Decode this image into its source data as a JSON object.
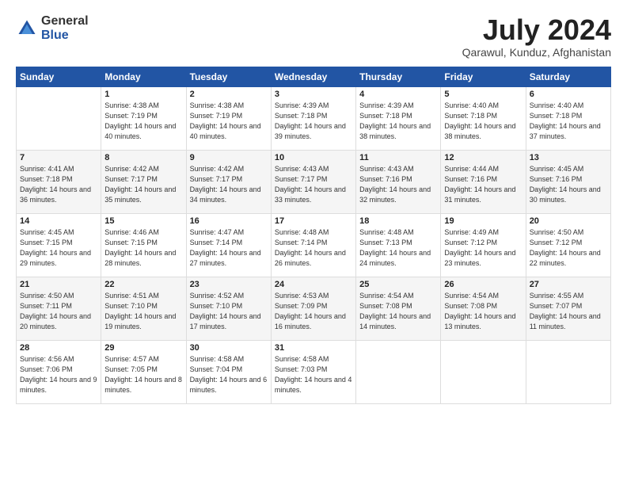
{
  "logo": {
    "general": "General",
    "blue": "Blue"
  },
  "title": "July 2024",
  "location": "Qarawul, Kunduz, Afghanistan",
  "days_header": [
    "Sunday",
    "Monday",
    "Tuesday",
    "Wednesday",
    "Thursday",
    "Friday",
    "Saturday"
  ],
  "weeks": [
    [
      {
        "num": "",
        "sunrise": "",
        "sunset": "",
        "daylight": ""
      },
      {
        "num": "1",
        "sunrise": "Sunrise: 4:38 AM",
        "sunset": "Sunset: 7:19 PM",
        "daylight": "Daylight: 14 hours and 40 minutes."
      },
      {
        "num": "2",
        "sunrise": "Sunrise: 4:38 AM",
        "sunset": "Sunset: 7:19 PM",
        "daylight": "Daylight: 14 hours and 40 minutes."
      },
      {
        "num": "3",
        "sunrise": "Sunrise: 4:39 AM",
        "sunset": "Sunset: 7:18 PM",
        "daylight": "Daylight: 14 hours and 39 minutes."
      },
      {
        "num": "4",
        "sunrise": "Sunrise: 4:39 AM",
        "sunset": "Sunset: 7:18 PM",
        "daylight": "Daylight: 14 hours and 38 minutes."
      },
      {
        "num": "5",
        "sunrise": "Sunrise: 4:40 AM",
        "sunset": "Sunset: 7:18 PM",
        "daylight": "Daylight: 14 hours and 38 minutes."
      },
      {
        "num": "6",
        "sunrise": "Sunrise: 4:40 AM",
        "sunset": "Sunset: 7:18 PM",
        "daylight": "Daylight: 14 hours and 37 minutes."
      }
    ],
    [
      {
        "num": "7",
        "sunrise": "Sunrise: 4:41 AM",
        "sunset": "Sunset: 7:18 PM",
        "daylight": "Daylight: 14 hours and 36 minutes."
      },
      {
        "num": "8",
        "sunrise": "Sunrise: 4:42 AM",
        "sunset": "Sunset: 7:17 PM",
        "daylight": "Daylight: 14 hours and 35 minutes."
      },
      {
        "num": "9",
        "sunrise": "Sunrise: 4:42 AM",
        "sunset": "Sunset: 7:17 PM",
        "daylight": "Daylight: 14 hours and 34 minutes."
      },
      {
        "num": "10",
        "sunrise": "Sunrise: 4:43 AM",
        "sunset": "Sunset: 7:17 PM",
        "daylight": "Daylight: 14 hours and 33 minutes."
      },
      {
        "num": "11",
        "sunrise": "Sunrise: 4:43 AM",
        "sunset": "Sunset: 7:16 PM",
        "daylight": "Daylight: 14 hours and 32 minutes."
      },
      {
        "num": "12",
        "sunrise": "Sunrise: 4:44 AM",
        "sunset": "Sunset: 7:16 PM",
        "daylight": "Daylight: 14 hours and 31 minutes."
      },
      {
        "num": "13",
        "sunrise": "Sunrise: 4:45 AM",
        "sunset": "Sunset: 7:16 PM",
        "daylight": "Daylight: 14 hours and 30 minutes."
      }
    ],
    [
      {
        "num": "14",
        "sunrise": "Sunrise: 4:45 AM",
        "sunset": "Sunset: 7:15 PM",
        "daylight": "Daylight: 14 hours and 29 minutes."
      },
      {
        "num": "15",
        "sunrise": "Sunrise: 4:46 AM",
        "sunset": "Sunset: 7:15 PM",
        "daylight": "Daylight: 14 hours and 28 minutes."
      },
      {
        "num": "16",
        "sunrise": "Sunrise: 4:47 AM",
        "sunset": "Sunset: 7:14 PM",
        "daylight": "Daylight: 14 hours and 27 minutes."
      },
      {
        "num": "17",
        "sunrise": "Sunrise: 4:48 AM",
        "sunset": "Sunset: 7:14 PM",
        "daylight": "Daylight: 14 hours and 26 minutes."
      },
      {
        "num": "18",
        "sunrise": "Sunrise: 4:48 AM",
        "sunset": "Sunset: 7:13 PM",
        "daylight": "Daylight: 14 hours and 24 minutes."
      },
      {
        "num": "19",
        "sunrise": "Sunrise: 4:49 AM",
        "sunset": "Sunset: 7:12 PM",
        "daylight": "Daylight: 14 hours and 23 minutes."
      },
      {
        "num": "20",
        "sunrise": "Sunrise: 4:50 AM",
        "sunset": "Sunset: 7:12 PM",
        "daylight": "Daylight: 14 hours and 22 minutes."
      }
    ],
    [
      {
        "num": "21",
        "sunrise": "Sunrise: 4:50 AM",
        "sunset": "Sunset: 7:11 PM",
        "daylight": "Daylight: 14 hours and 20 minutes."
      },
      {
        "num": "22",
        "sunrise": "Sunrise: 4:51 AM",
        "sunset": "Sunset: 7:10 PM",
        "daylight": "Daylight: 14 hours and 19 minutes."
      },
      {
        "num": "23",
        "sunrise": "Sunrise: 4:52 AM",
        "sunset": "Sunset: 7:10 PM",
        "daylight": "Daylight: 14 hours and 17 minutes."
      },
      {
        "num": "24",
        "sunrise": "Sunrise: 4:53 AM",
        "sunset": "Sunset: 7:09 PM",
        "daylight": "Daylight: 14 hours and 16 minutes."
      },
      {
        "num": "25",
        "sunrise": "Sunrise: 4:54 AM",
        "sunset": "Sunset: 7:08 PM",
        "daylight": "Daylight: 14 hours and 14 minutes."
      },
      {
        "num": "26",
        "sunrise": "Sunrise: 4:54 AM",
        "sunset": "Sunset: 7:08 PM",
        "daylight": "Daylight: 14 hours and 13 minutes."
      },
      {
        "num": "27",
        "sunrise": "Sunrise: 4:55 AM",
        "sunset": "Sunset: 7:07 PM",
        "daylight": "Daylight: 14 hours and 11 minutes."
      }
    ],
    [
      {
        "num": "28",
        "sunrise": "Sunrise: 4:56 AM",
        "sunset": "Sunset: 7:06 PM",
        "daylight": "Daylight: 14 hours and 9 minutes."
      },
      {
        "num": "29",
        "sunrise": "Sunrise: 4:57 AM",
        "sunset": "Sunset: 7:05 PM",
        "daylight": "Daylight: 14 hours and 8 minutes."
      },
      {
        "num": "30",
        "sunrise": "Sunrise: 4:58 AM",
        "sunset": "Sunset: 7:04 PM",
        "daylight": "Daylight: 14 hours and 6 minutes."
      },
      {
        "num": "31",
        "sunrise": "Sunrise: 4:58 AM",
        "sunset": "Sunset: 7:03 PM",
        "daylight": "Daylight: 14 hours and 4 minutes."
      },
      {
        "num": "",
        "sunrise": "",
        "sunset": "",
        "daylight": ""
      },
      {
        "num": "",
        "sunrise": "",
        "sunset": "",
        "daylight": ""
      },
      {
        "num": "",
        "sunrise": "",
        "sunset": "",
        "daylight": ""
      }
    ]
  ]
}
